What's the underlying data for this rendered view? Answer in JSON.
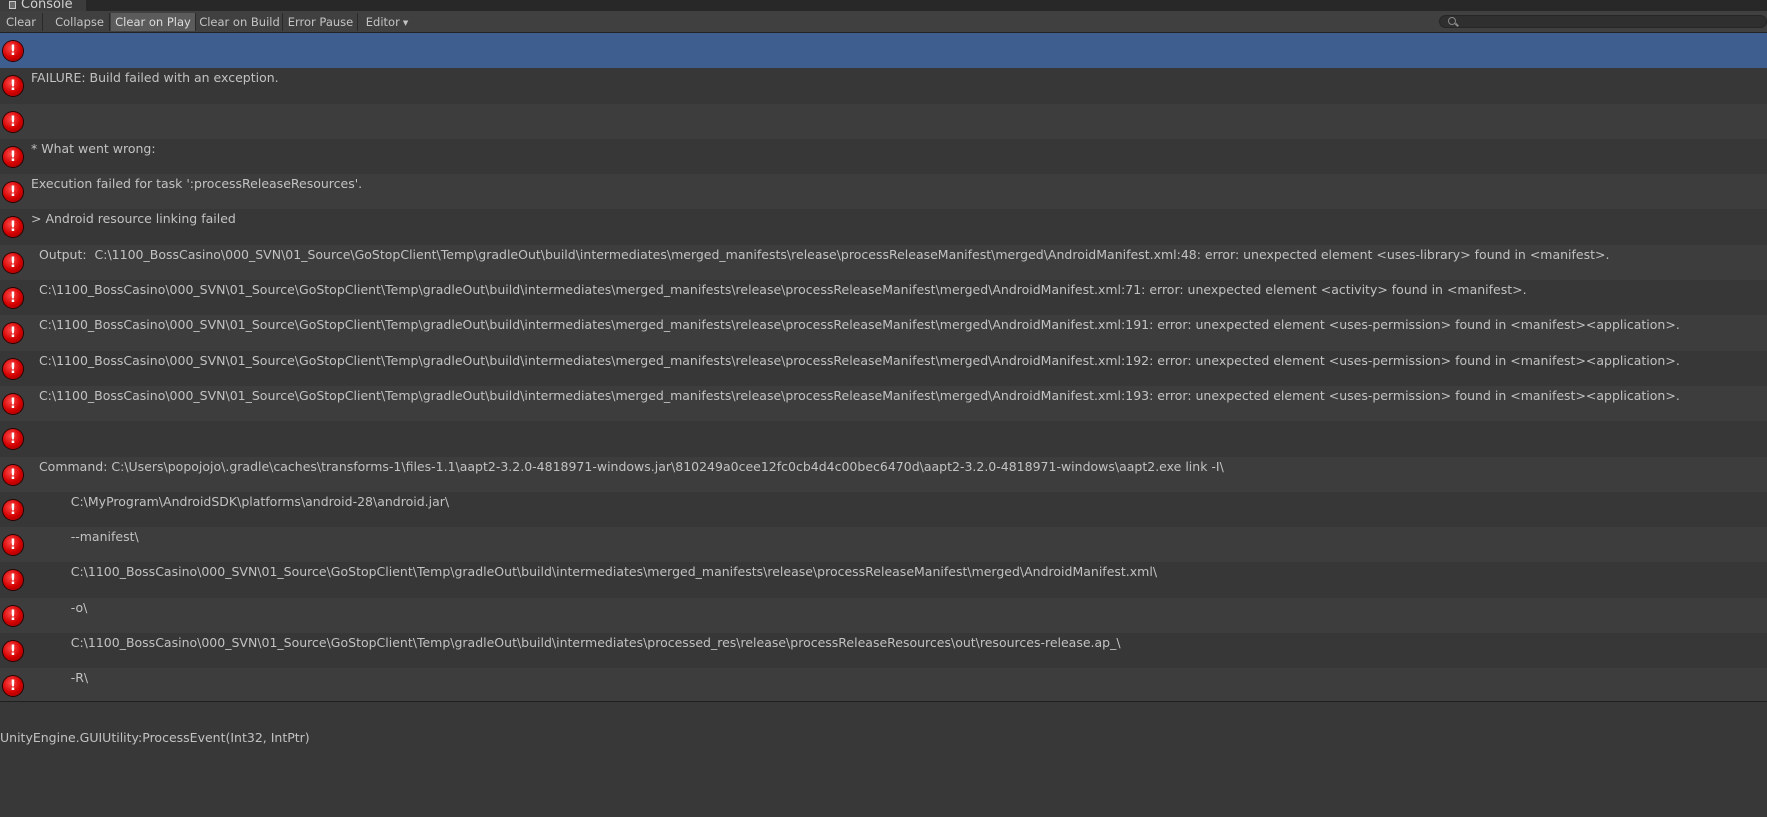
{
  "window": {
    "tab_title": "Console"
  },
  "toolbar": {
    "buttons": [
      {
        "label": "Clear",
        "active": false
      },
      {
        "label": "Collapse",
        "active": false
      },
      {
        "label": "Clear on Play",
        "active": true
      },
      {
        "label": "Clear on Build",
        "active": false
      },
      {
        "label": "Error Pause",
        "active": false
      },
      {
        "label": "Editor",
        "active": false,
        "dropdown": true
      }
    ],
    "search_value": "",
    "search_placeholder": ""
  },
  "colors": {
    "selected_row": "#3d5e8f",
    "error_icon": "#d40000",
    "background": "#383838"
  },
  "log": {
    "entries": [
      {
        "icon": "error-icon",
        "text": "",
        "selected": true
      },
      {
        "icon": "error-icon",
        "text": "FAILURE: Build failed with an exception."
      },
      {
        "icon": "error-icon",
        "text": ""
      },
      {
        "icon": "error-icon",
        "text": "* What went wrong:"
      },
      {
        "icon": "error-icon",
        "text": "Execution failed for task ':processReleaseResources'."
      },
      {
        "icon": "error-icon",
        "text": "> Android resource linking failed"
      },
      {
        "icon": "error-icon",
        "text": "  Output:  C:\\1100_BossCasino\\000_SVN\\01_Source\\GoStopClient\\Temp\\gradleOut\\build\\intermediates\\merged_manifests\\release\\processReleaseManifest\\merged\\AndroidManifest.xml:48: error: unexpected element <uses-library> found in <manifest>."
      },
      {
        "icon": "error-icon",
        "text": "  C:\\1100_BossCasino\\000_SVN\\01_Source\\GoStopClient\\Temp\\gradleOut\\build\\intermediates\\merged_manifests\\release\\processReleaseManifest\\merged\\AndroidManifest.xml:71: error: unexpected element <activity> found in <manifest>."
      },
      {
        "icon": "error-icon",
        "text": "  C:\\1100_BossCasino\\000_SVN\\01_Source\\GoStopClient\\Temp\\gradleOut\\build\\intermediates\\merged_manifests\\release\\processReleaseManifest\\merged\\AndroidManifest.xml:191: error: unexpected element <uses-permission> found in <manifest><application>."
      },
      {
        "icon": "error-icon",
        "text": "  C:\\1100_BossCasino\\000_SVN\\01_Source\\GoStopClient\\Temp\\gradleOut\\build\\intermediates\\merged_manifests\\release\\processReleaseManifest\\merged\\AndroidManifest.xml:192: error: unexpected element <uses-permission> found in <manifest><application>."
      },
      {
        "icon": "error-icon",
        "text": "  C:\\1100_BossCasino\\000_SVN\\01_Source\\GoStopClient\\Temp\\gradleOut\\build\\intermediates\\merged_manifests\\release\\processReleaseManifest\\merged\\AndroidManifest.xml:193: error: unexpected element <uses-permission> found in <manifest><application>."
      },
      {
        "icon": "error-icon",
        "text": ""
      },
      {
        "icon": "error-icon",
        "text": "  Command: C:\\Users\\popojojo\\.gradle\\caches\\transforms-1\\files-1.1\\aapt2-3.2.0-4818971-windows.jar\\810249a0cee12fc0cb4d4c00bec6470d\\aapt2-3.2.0-4818971-windows\\aapt2.exe link -I\\"
      },
      {
        "icon": "error-icon",
        "text": "          C:\\MyProgram\\AndroidSDK\\platforms\\android-28\\android.jar\\"
      },
      {
        "icon": "error-icon",
        "text": "          --manifest\\"
      },
      {
        "icon": "error-icon",
        "text": "          C:\\1100_BossCasino\\000_SVN\\01_Source\\GoStopClient\\Temp\\gradleOut\\build\\intermediates\\merged_manifests\\release\\processReleaseManifest\\merged\\AndroidManifest.xml\\"
      },
      {
        "icon": "error-icon",
        "text": "          -o\\"
      },
      {
        "icon": "error-icon",
        "text": "          C:\\1100_BossCasino\\000_SVN\\01_Source\\GoStopClient\\Temp\\gradleOut\\build\\intermediates\\processed_res\\release\\processReleaseResources\\out\\resources-release.ap_\\"
      },
      {
        "icon": "error-icon",
        "text": "          -R\\"
      }
    ]
  },
  "detail": {
    "text": "UnityEngine.GUIUtility:ProcessEvent(Int32, IntPtr)"
  }
}
